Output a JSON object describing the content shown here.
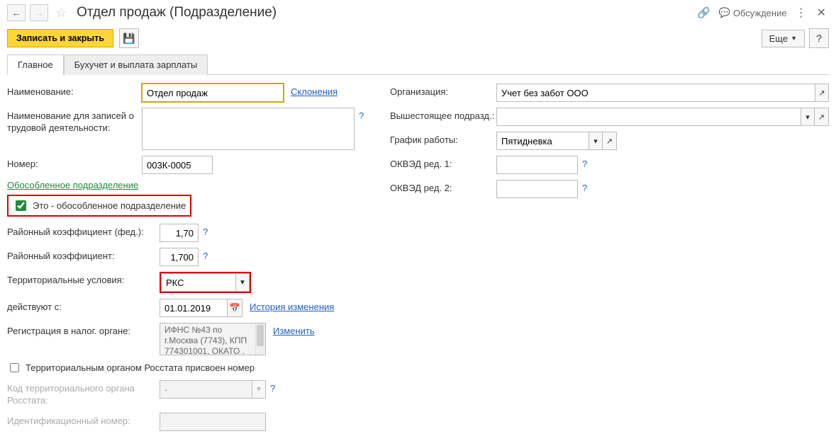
{
  "title": "Отдел продаж (Подразделение)",
  "titlebar_buttons": {
    "discuss": "Обсуждение"
  },
  "toolbar": {
    "save_close": "Записать и закрыть",
    "more": "Еще",
    "help": "?"
  },
  "tabs": {
    "main": "Главное",
    "accounting": "Бухучет и выплата зарплаты"
  },
  "left": {
    "name_label": "Наименование:",
    "name_value": "Отдел продаж",
    "declensions_link": "Склонения",
    "labor_label": "Наименование для записей о трудовой деятельности:",
    "labor_value": "",
    "number_label": "Номер:",
    "number_value": "003К-0005",
    "sep_header": "Обособленное подразделение",
    "sep_check_label": "Это - обособленное подразделение",
    "fed_coef_label": "Районный коэффициент (фед.):",
    "fed_coef_value": "1,70",
    "coef_label": "Районный коэффициент:",
    "coef_value": "1,700",
    "terr_label": "Территориальные условия:",
    "terr_value": "РКС",
    "valid_from_label": "действуют с:",
    "valid_from_value": "01.01.2019",
    "history_link": "История изменения",
    "tax_reg_label": "Регистрация в налог. органе:",
    "tax_reg_value": "ИФНС №43 по г.Москва (7743), КПП 774301001, ОКАТО .",
    "change_link": "Изменить",
    "rosstat_check_label": "Территориальным органом Росстата присвоен номер",
    "rosstat_code_label": "Код территориального органа Росстата:",
    "rosstat_code_value": "-",
    "id_num_label": "Идентификационный номер:"
  },
  "right": {
    "org_label": "Организация:",
    "org_value": "Учет без забот ООО",
    "parent_label": "Вышестоящее подразд.:",
    "parent_value": "",
    "schedule_label": "График работы:",
    "schedule_value": "Пятидневка",
    "okved1_label": "ОКВЭД ред. 1:",
    "okved2_label": "ОКВЭД ред. 2:"
  }
}
